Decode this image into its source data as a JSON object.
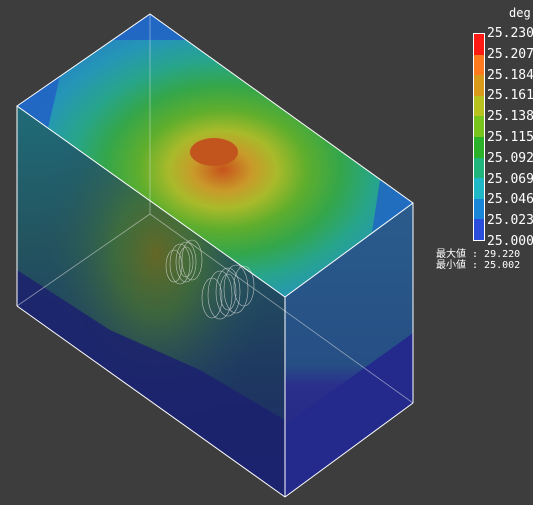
{
  "legend": {
    "unit": "deg",
    "ticks": [
      "25.230",
      "25.207",
      "25.184",
      "25.161",
      "25.138",
      "25.115",
      "25.092",
      "25.069",
      "25.046",
      "25.023",
      "25.000"
    ],
    "colors": [
      "#ff1a14",
      "#ff7a1c",
      "#d99a1a",
      "#b8c21e",
      "#76c41c",
      "#2cb12a",
      "#20b57c",
      "#1fb8c6",
      "#1a86d9",
      "#2a4ddc"
    ]
  },
  "stats": {
    "max_label": "最大値 : 29.220",
    "min_label": "最小値 : 25.002"
  },
  "colors": {
    "background": "#3d3d3d",
    "edge": "#ffffff"
  }
}
